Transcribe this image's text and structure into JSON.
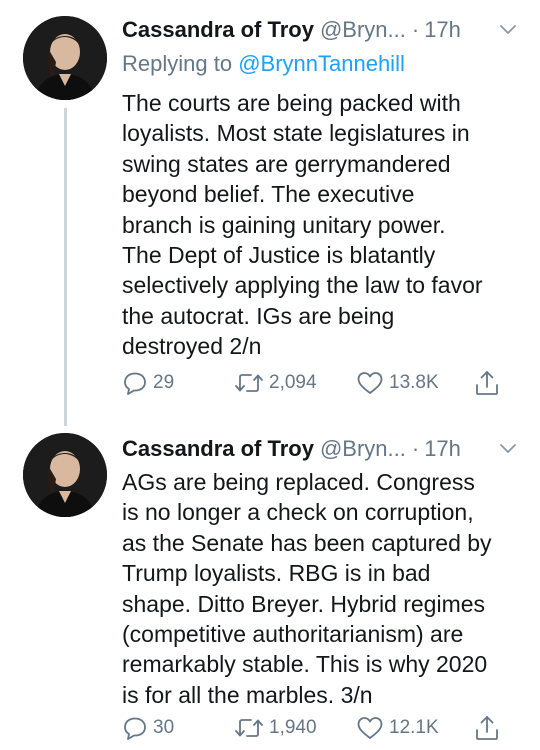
{
  "tweets": [
    {
      "display_name": "Cassandra of Troy",
      "handle": "@Bryn...",
      "dot": "·",
      "time": "17h",
      "reply_prefix": "Replying to",
      "reply_mention": "@BrynnTannehill",
      "text_lines": [
        "The courts are being packed with",
        "loyalists. Most state legislatures in",
        "swing states are gerrymandered",
        "beyond belief. The executive",
        "branch is gaining unitary power.",
        "The Dept of Justice is blatantly",
        "selectively applying the law to favor",
        "the autocrat. IGs are being",
        "destroyed 2/n"
      ],
      "replies": "29",
      "retweets": "2,094",
      "likes": "13.8K"
    },
    {
      "display_name": "Cassandra of Troy",
      "handle": "@Bryn...",
      "dot": "·",
      "time": "17h",
      "text_lines": [
        "AGs are being replaced. Congress",
        "is no longer a check on corruption,",
        "as the Senate has been captured by",
        "Trump loyalists. RBG is in bad",
        "shape. Ditto Breyer. Hybrid regimes",
        "(competitive authoritarianism) are",
        "remarkably stable. This is why 2020",
        "is for all the marbles. 3/n"
      ],
      "replies": "30",
      "retweets": "1,940",
      "likes": "12.1K"
    }
  ],
  "icons": {
    "reply": "reply-icon",
    "retweet": "retweet-icon",
    "like": "heart-icon",
    "share": "share-icon",
    "caret": "chevron-down-icon"
  },
  "colors": {
    "text": "#14171a",
    "secondary": "#657786",
    "link": "#1da1f2",
    "thread_line": "#ccd6dd"
  }
}
